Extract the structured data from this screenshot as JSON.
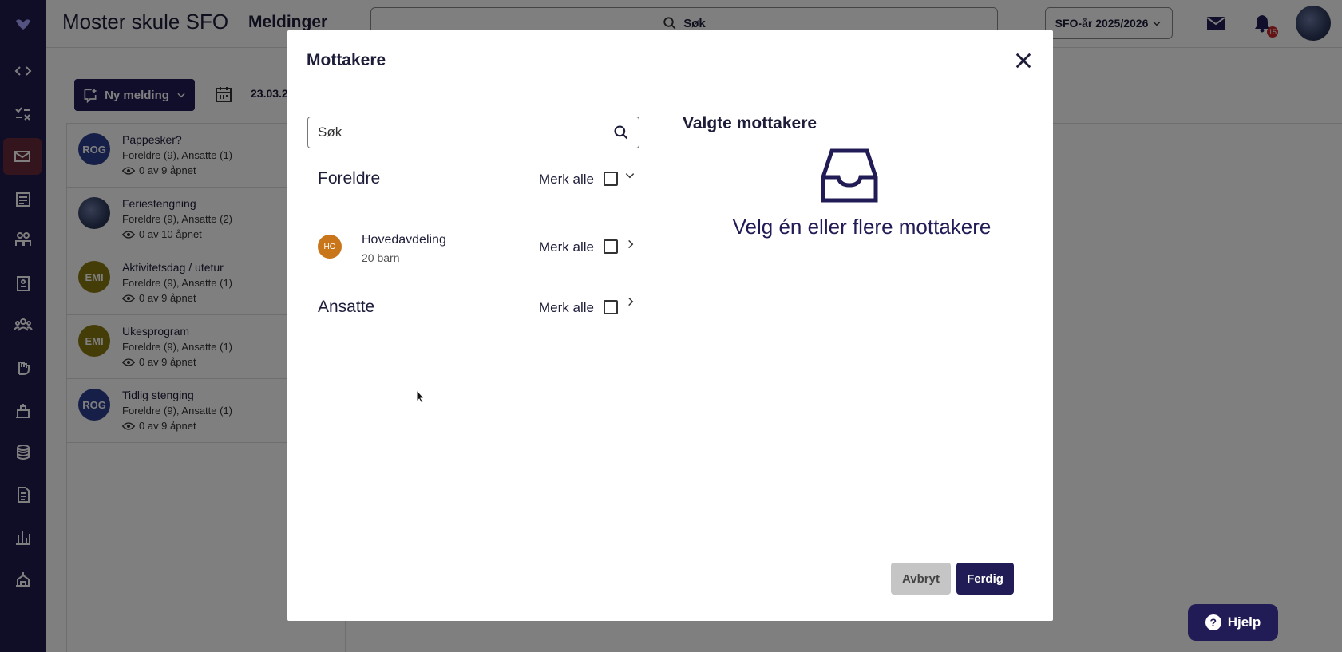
{
  "app": {
    "school_name": "Moster skule SFO",
    "page_title": "Meldinger",
    "search_label": "Søk",
    "year_selector": "SFO-år 2025/2026",
    "notification_count": "15",
    "help_label": "Hjelp"
  },
  "toolbar": {
    "new_message_label": "Ny melding",
    "date_text": "23.03.2"
  },
  "messages": [
    {
      "initials": "ROG",
      "avatar_color": "#2c3e8f",
      "title": "Pappesker?",
      "recipients": "Foreldre (9), Ansatte (1)",
      "opened": "0 av 9 åpnet"
    },
    {
      "initials": "",
      "avatar_color": "#3a4a7a",
      "title": "Feriestengning",
      "recipients": "Foreldre (9), Ansatte (2)",
      "opened": "0 av 10 åpnet"
    },
    {
      "initials": "EMI",
      "avatar_color": "#8a7a10",
      "title": "Aktivitetsdag / utetur",
      "recipients": "Foreldre (9), Ansatte (1)",
      "opened": "0 av 9 åpnet"
    },
    {
      "initials": "EMI",
      "avatar_color": "#8a7a10",
      "title": "Ukesprogram",
      "recipients": "Foreldre (9), Ansatte (1)",
      "opened": "0 av 9 åpnet"
    },
    {
      "initials": "ROG",
      "avatar_color": "#2c3e8f",
      "title": "Tidlig stenging",
      "recipients": "Foreldre (9), Ansatte (1)",
      "opened": "0 av 9 åpnet"
    }
  ],
  "modal": {
    "title": "Mottakere",
    "search_placeholder": "Søk",
    "select_all_label": "Merk alle",
    "groups": {
      "parents": {
        "title": "Foreldre",
        "checked": false,
        "expanded": true
      },
      "department": {
        "initials": "HO",
        "name": "Hovedavdeling",
        "count": "20 barn",
        "checked": false
      },
      "staff": {
        "title": "Ansatte",
        "checked": false,
        "expanded": false
      }
    },
    "selected_title": "Valgte mottakere",
    "empty_text": "Velg én eller flere mottakere",
    "cancel_label": "Avbryt",
    "done_label": "Ferdig"
  },
  "colors": {
    "brand_dark": "#221c56",
    "rail": "#201b4d",
    "active_rail": "#6b2b3a",
    "department_avatar": "#c9761b"
  }
}
